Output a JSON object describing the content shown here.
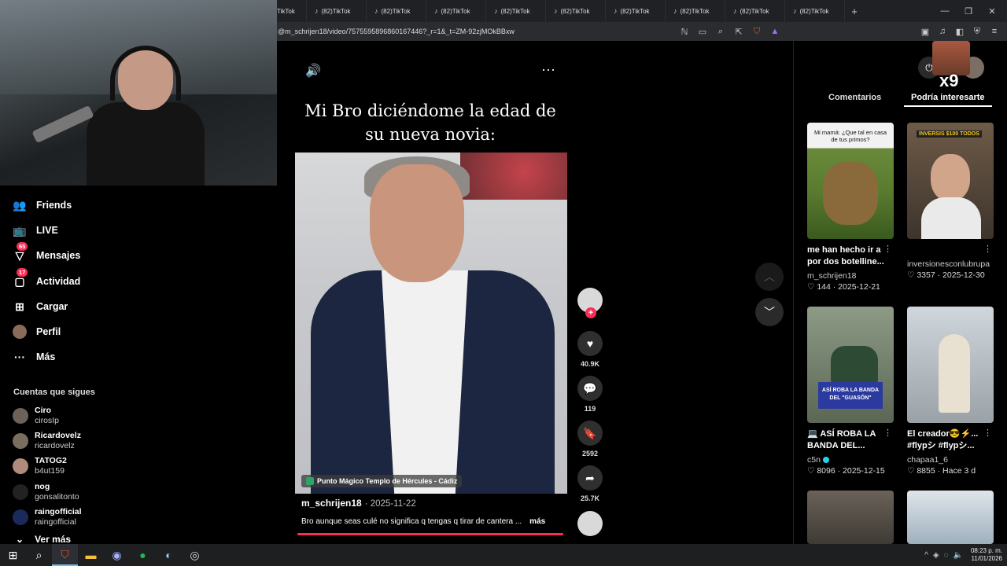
{
  "browser": {
    "tabs": [
      "TikTok",
      "(82)TikTok",
      "(82)TikTok",
      "(82)TikTok",
      "(82)TikTok",
      "(82)TikTok",
      "(82)TikTok",
      "(82)TikTok",
      "(82)TikTok",
      "(82)TikTok",
      "(82)TikTok"
    ],
    "url": "@m_schrijen18/video/7575595896860167446?_r=1&_t=ZM-92zjMOkBBxw"
  },
  "sidebar": {
    "nav": [
      {
        "label": "Friends",
        "icon": "friends-icon"
      },
      {
        "label": "LIVE",
        "icon": "live-icon"
      },
      {
        "label": "Mensajes",
        "icon": "messages-icon",
        "badge": "65"
      },
      {
        "label": "Actividad",
        "icon": "activity-icon",
        "badge": "17"
      },
      {
        "label": "Cargar",
        "icon": "upload-icon"
      },
      {
        "label": "Perfil",
        "icon": "profile-icon"
      },
      {
        "label": "Más",
        "icon": "more-icon"
      }
    ],
    "following_title": "Cuentas que sigues",
    "following": [
      {
        "name": "Ciro",
        "handle": "cirosIp"
      },
      {
        "name": "Ricardovelz",
        "handle": "ricardovelz"
      },
      {
        "name": "TATOG2",
        "handle": "b4ut159"
      },
      {
        "name": "nog",
        "handle": "gonsalitonto"
      },
      {
        "name": "raingofficial",
        "handle": "raingofficial"
      }
    ],
    "see_more": "Ver más"
  },
  "video": {
    "caption": "Mi Bro diciéndome la edad de su nueva novia:",
    "location": "Punto Mágico Templo de Hércules - Cádiz",
    "author": "m_schrijen18",
    "date": "· 2025-11-22",
    "description": "Bro aunque seas culé no significa q tengas q tirar de cantera ...",
    "more": "más",
    "likes": "40.9K",
    "comments": "119",
    "saves": "2592",
    "shares": "25.7K",
    "progress_fraction": 1.0
  },
  "right_panel": {
    "tab_comments": "Comentarios",
    "tab_interest": "Podría interesarte",
    "sticker_text": "x9",
    "cards": [
      {
        "title": "me han hecho ir a por dos botelline...",
        "author": "m_schrijen18",
        "stats": "♡ 144 · 2025-12-21",
        "thumb_text": "Mi mamá: ¿Que tal en casa de tus primos?",
        "verified": false
      },
      {
        "title": "",
        "author": "inversionesconlubrupa",
        "stats": "♡ 3357 · 2025-12-30",
        "thumb_text": "INVERSIS $100 TODOS",
        "verified": false
      },
      {
        "title": "💻 ASÍ ROBA LA BANDA DEL...",
        "author": "c5n",
        "stats": "♡ 8096 · 2025-12-15",
        "thumb_text": "ASÍ ROBA LA BANDA DEL \"GUASÓN\"",
        "verified": true
      },
      {
        "title": "El creador😎⚡... #flypシ #flypシ...",
        "author": "chapaa1_6",
        "stats": "♡ 8855 · Hace 3 d",
        "thumb_text": "",
        "verified": false
      }
    ]
  },
  "taskbar": {
    "time": "08:23 p. m.",
    "date": "11/01/2026"
  }
}
